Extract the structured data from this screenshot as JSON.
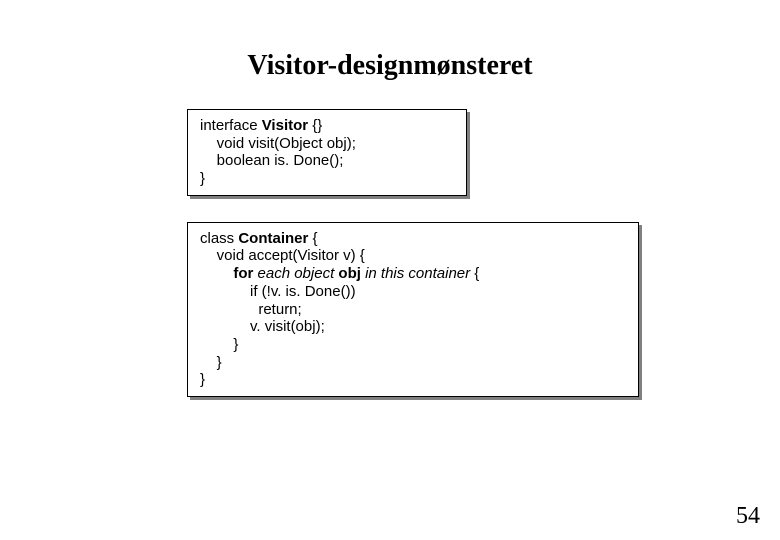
{
  "title": "Visitor-designmønsteret",
  "page_number": "54",
  "box1": {
    "l1a": "interface ",
    "l1b": "Visitor",
    "l1c": " {}",
    "l2": "    void visit(Object obj);",
    "l3": "    boolean is. Done();",
    "l4": "}"
  },
  "box2": {
    "l1a": "class ",
    "l1b": "Container",
    "l1c": " {",
    "l2": "    void accept(Visitor v) {",
    "l3a": "        for ",
    "l3b": "each object",
    "l3c": " obj ",
    "l3d": "in this container",
    "l3e": " {",
    "l4": "            if (!v. is. Done())",
    "l5": "              return;",
    "l6": "            v. visit(obj);",
    "l7": "        }",
    "l8": "    }",
    "l9": "}"
  }
}
